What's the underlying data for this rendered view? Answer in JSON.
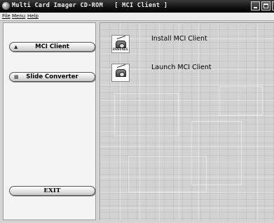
{
  "window": {
    "title": "Multi Card Imager CD-ROM   [ MCI Client ]"
  },
  "menu": {
    "items": [
      "File",
      "Menu",
      "Help"
    ]
  },
  "sidebar": {
    "buttons": [
      {
        "label": "MCI Client",
        "icon": "radio-icon"
      },
      {
        "label": "Slide Converter",
        "icon": "slide-icon"
      }
    ],
    "exit_label": "EXIT"
  },
  "main": {
    "items": [
      {
        "label": "Install MCI Client",
        "icon": "radio-install-icon",
        "icon_caption": "INSTALL"
      },
      {
        "label": "Launch MCI Client",
        "icon": "radio-launch-icon"
      }
    ]
  }
}
